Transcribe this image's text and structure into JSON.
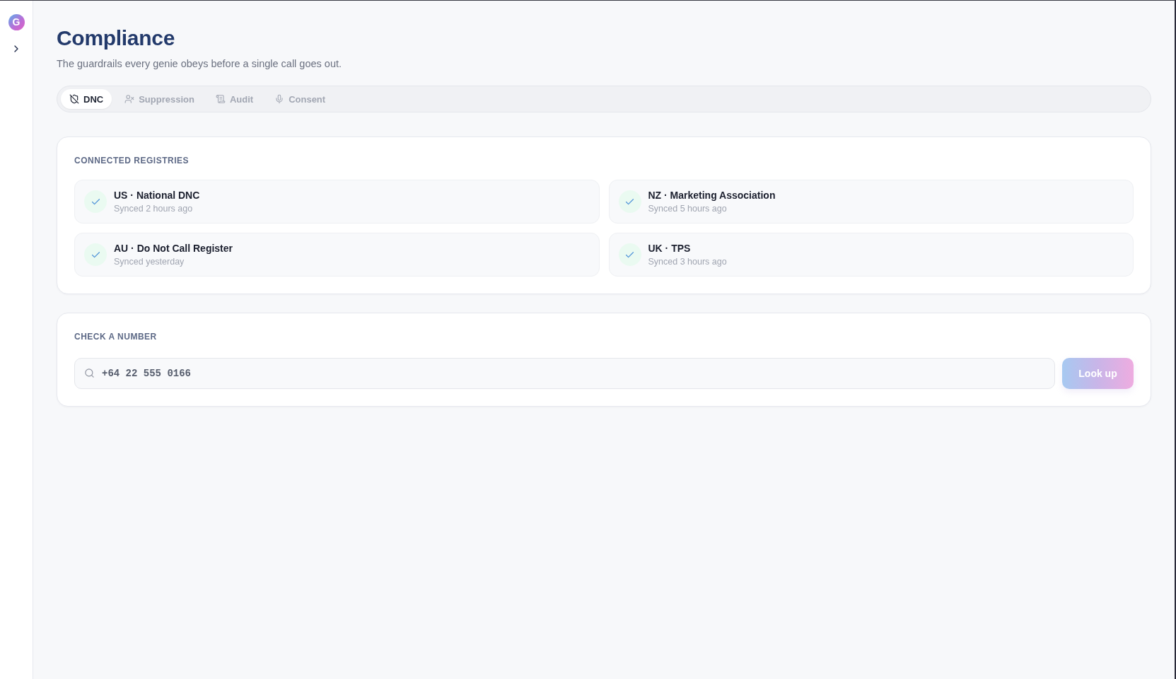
{
  "sidebar": {
    "logo": "G"
  },
  "header": {
    "title": "Compliance",
    "subtitle": "The guardrails every genie obeys before a single call goes out."
  },
  "tabs": [
    {
      "label": "DNC",
      "selected": true
    },
    {
      "label": "Suppression",
      "selected": false
    },
    {
      "label": "Audit",
      "selected": false
    },
    {
      "label": "Consent",
      "selected": false
    }
  ],
  "registries": {
    "heading": "CONNECTED REGISTRIES",
    "items": [
      {
        "name": "US · National DNC",
        "synced": "Synced 2 hours ago",
        "connected": true
      },
      {
        "name": "NZ · Marketing Association",
        "synced": "Synced 5 hours ago",
        "connected": true
      },
      {
        "name": "AU · Do Not Call Register",
        "synced": "Synced yesterday",
        "connected": true
      },
      {
        "name": "UK · TPS",
        "synced": "Synced 3 hours ago",
        "connected": true
      }
    ]
  },
  "lookup": {
    "heading": "CHECK A NUMBER",
    "value": "+64 22 555 0166",
    "button": "Look up"
  }
}
